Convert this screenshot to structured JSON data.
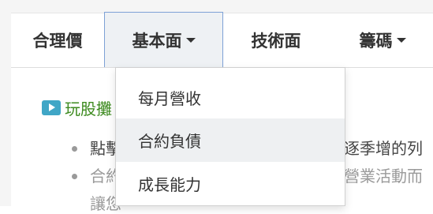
{
  "tabs": [
    {
      "label": "合理價"
    },
    {
      "label": "基本面"
    },
    {
      "label": "技術面"
    },
    {
      "label": "籌碼"
    }
  ],
  "dropdown": {
    "items": [
      {
        "label": "每月營收"
      },
      {
        "label": "合約負債"
      },
      {
        "label": "成長能力"
      }
    ]
  },
  "content": {
    "promo_text": "玩股攤",
    "bullets": [
      {
        "text": "點擊",
        "tail": "逐季增的列"
      },
      {
        "text": "合約",
        "tail": "營業活動而"
      },
      {
        "text": "讓您"
      }
    ]
  },
  "colors": {
    "active_tab_border": "#7da1d6",
    "promo_green": "#3c8a1e",
    "play_icon": "#40a6c6",
    "highlight_item": "#eef0f2"
  }
}
